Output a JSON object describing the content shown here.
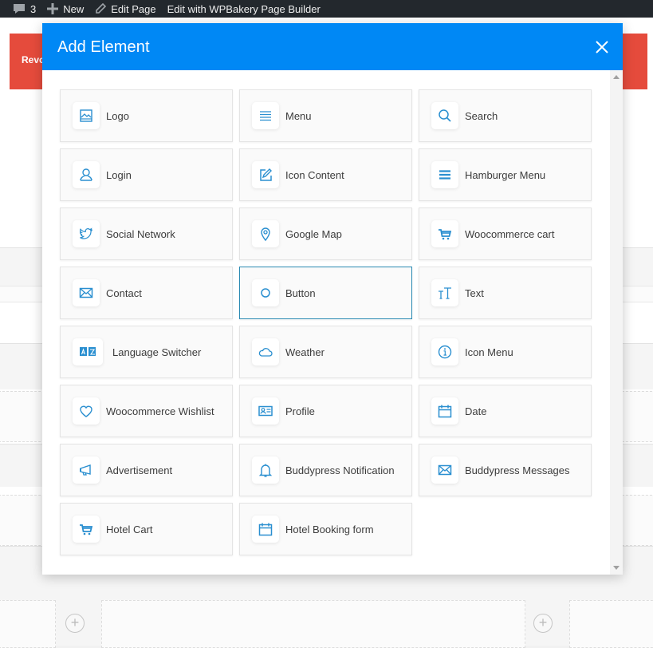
{
  "adminbar": {
    "comments_count": "3",
    "new_label": "New",
    "edit_page_label": "Edit Page",
    "wpbakery_label": "Edit with WPBakery Page Builder"
  },
  "background": {
    "banner_text": "Revo"
  },
  "modal": {
    "title": "Add Element",
    "header_color": "#0088f5",
    "icon_color": "#2a8fd0",
    "elements": [
      {
        "label": "Logo",
        "icon": "image-icon"
      },
      {
        "label": "Menu",
        "icon": "menu-lines-icon"
      },
      {
        "label": "Search",
        "icon": "search-icon"
      },
      {
        "label": "Login",
        "icon": "user-icon"
      },
      {
        "label": "Icon Content",
        "icon": "edit-icon"
      },
      {
        "label": "Hamburger Menu",
        "icon": "hamburger-icon"
      },
      {
        "label": "Social Network",
        "icon": "twitter-icon"
      },
      {
        "label": "Google Map",
        "icon": "map-pin-icon"
      },
      {
        "label": "Woocommerce cart",
        "icon": "cart-icon"
      },
      {
        "label": "Contact",
        "icon": "envelope-icon"
      },
      {
        "label": "Button",
        "icon": "circle-icon",
        "active": true
      },
      {
        "label": "Text",
        "icon": "text-size-icon"
      },
      {
        "label": "Language Switcher",
        "icon": "translate-icon"
      },
      {
        "label": "Weather",
        "icon": "cloud-icon"
      },
      {
        "label": "Icon Menu",
        "icon": "info-icon"
      },
      {
        "label": "Woocommerce Wishlist",
        "icon": "heart-icon"
      },
      {
        "label": "Profile",
        "icon": "id-card-icon"
      },
      {
        "label": "Date",
        "icon": "calendar-icon"
      },
      {
        "label": "Advertisement",
        "icon": "megaphone-icon"
      },
      {
        "label": "Buddypress Notification",
        "icon": "bell-icon"
      },
      {
        "label": "Buddypress Messages",
        "icon": "envelope-icon"
      },
      {
        "label": "Hotel Cart",
        "icon": "cart-icon"
      },
      {
        "label": "Hotel Booking form",
        "icon": "calendar-icon"
      }
    ]
  }
}
